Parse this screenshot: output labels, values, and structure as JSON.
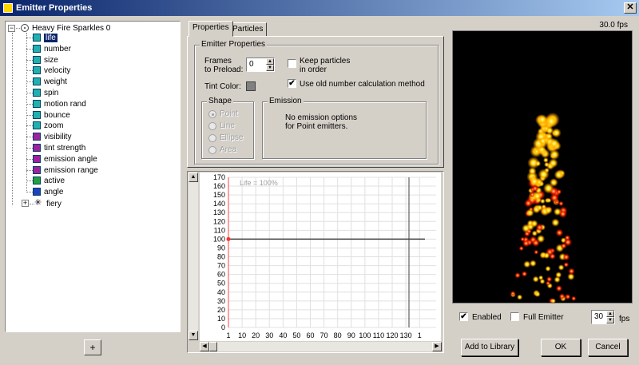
{
  "window": {
    "title": "Emitter Properties",
    "close_label": "✕"
  },
  "tree": {
    "root_label": "Heavy Fire Sparkles 0",
    "items": [
      {
        "label": "life",
        "color": "#20b0b0",
        "selected": true
      },
      {
        "label": "number",
        "color": "#20b0b0"
      },
      {
        "label": "size",
        "color": "#20b0b0"
      },
      {
        "label": "velocity",
        "color": "#20b0b0"
      },
      {
        "label": "weight",
        "color": "#20b0b0"
      },
      {
        "label": "spin",
        "color": "#20b0b0"
      },
      {
        "label": "motion rand",
        "color": "#20b0b0"
      },
      {
        "label": "bounce",
        "color": "#20b0b0"
      },
      {
        "label": "zoom",
        "color": "#20b0b0"
      },
      {
        "label": "visibility",
        "color": "#a020a0"
      },
      {
        "label": "tint strength",
        "color": "#a020a0"
      },
      {
        "label": "emission angle",
        "color": "#a020a0"
      },
      {
        "label": "emission range",
        "color": "#a020a0"
      },
      {
        "label": "active",
        "color": "#20a040"
      },
      {
        "label": "angle",
        "color": "#2040c0"
      }
    ],
    "child_label": "fiery",
    "add_button_icon": "add-property-icon",
    "add_button_glyph": "+"
  },
  "tabs": [
    "Properties",
    "Particles"
  ],
  "emitter_props": {
    "group_title": "Emitter Properties",
    "frames_label_1": "Frames",
    "frames_label_2": "to Preload:",
    "frames_value": "0",
    "tint_label": "Tint Color:",
    "keep_label_1": "Keep particles",
    "keep_label_2": "in order",
    "keep_checked": false,
    "old_number_label": "Use old number calculation method",
    "old_number_checked": true,
    "check_mark": "✔",
    "shape_title": "Shape",
    "shapes": [
      "Point",
      "Line",
      "Ellipse",
      "Area"
    ],
    "emission_title": "Emission",
    "emission_text_1": "No emission options",
    "emission_text_2": "for Point emitters."
  },
  "graph": {
    "legend": "Life = 100%",
    "y_ticks": [
      170,
      160,
      150,
      140,
      130,
      120,
      110,
      100,
      90,
      80,
      70,
      60,
      50,
      40,
      30,
      20,
      10,
      0
    ],
    "x_ticks": [
      "1",
      "10",
      "20",
      "30",
      "40",
      "50",
      "60",
      "70",
      "80",
      "90",
      "100",
      "110",
      "120",
      "130",
      "1"
    ],
    "value": 100
  },
  "preview": {
    "fps_text": "30.0 fps",
    "enabled_label": "Enabled",
    "enabled_checked": true,
    "full_emitter_label": "Full Emitter",
    "full_emitter_checked": false,
    "fps_value": "30",
    "fps_unit": "fps"
  },
  "buttons": {
    "add_to_library": "Add to Library",
    "ok": "OK",
    "cancel": "Cancel"
  }
}
